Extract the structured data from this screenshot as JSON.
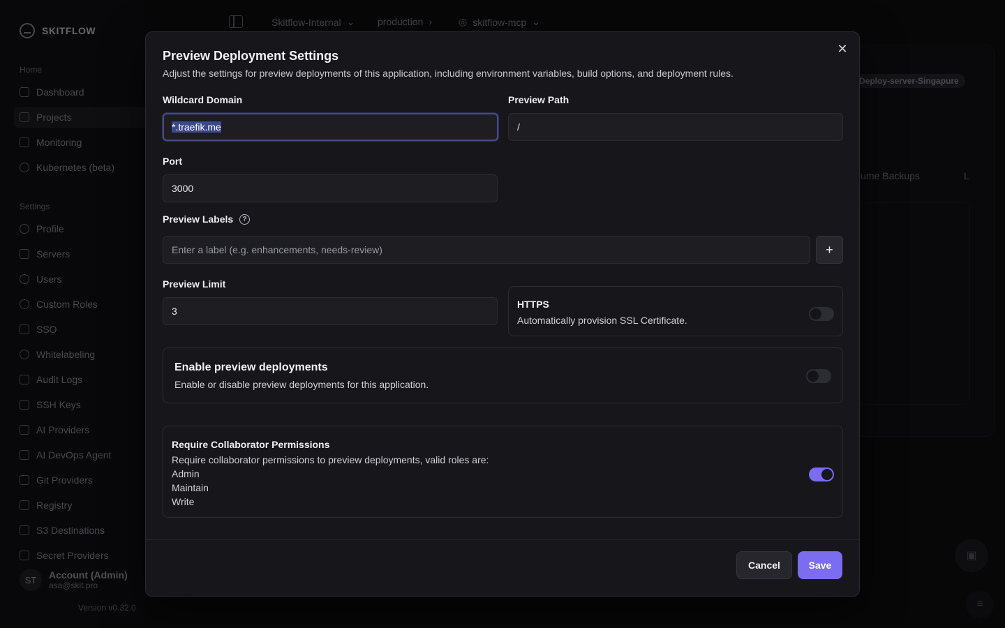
{
  "app": {
    "brand": "SKITFLOW",
    "sections": {
      "home": "Home",
      "settings": "Settings"
    },
    "nav_home": [
      "Dashboard",
      "Projects",
      "Monitoring",
      "Kubernetes (beta)"
    ],
    "nav_settings": [
      "Profile",
      "Servers",
      "Users",
      "Custom Roles",
      "SSO",
      "Whitelabeling",
      "Audit Logs",
      "SSH Keys",
      "AI Providers",
      "AI DevOps Agent",
      "Git Providers",
      "Registry",
      "S3 Destinations",
      "Secret Providers"
    ],
    "account": {
      "initials": "ST",
      "name": "Account (Admin)",
      "email": "asa@skit.pro"
    },
    "version": "Version v0.32.0",
    "breadcrumb": {
      "org": "Skitflow-Internal",
      "env": "production",
      "service": "skitflow-mcp"
    },
    "bg_badge": "Deploy-server-Singapure",
    "bg_tab": "lume Backups",
    "bg_tab_extra": "L"
  },
  "modal": {
    "title": "Preview Deployment Settings",
    "description": "Adjust the settings for preview deployments of this application, including environment variables, build options, and deployment rules.",
    "wildcard_domain": {
      "label": "Wildcard Domain",
      "value": "*.traefik.me"
    },
    "preview_path": {
      "label": "Preview Path",
      "value": "/"
    },
    "port": {
      "label": "Port",
      "value": "3000"
    },
    "preview_labels": {
      "label": "Preview Labels",
      "placeholder": "Enter a label (e.g. enhancements, needs-review)",
      "add_symbol": "+"
    },
    "preview_limit": {
      "label": "Preview Limit",
      "value": "3"
    },
    "https": {
      "title": "HTTPS",
      "description": "Automatically provision SSL Certificate.",
      "enabled": false
    },
    "enable_preview": {
      "title": "Enable preview deployments",
      "description": "Enable or disable preview deployments for this application.",
      "enabled": false
    },
    "collaborator": {
      "title": "Require Collaborator Permissions",
      "description": "Require collaborator permissions to preview deployments, valid roles are:",
      "roles": [
        "Admin",
        "Maintain",
        "Write"
      ],
      "enabled": true
    },
    "cancel_label": "Cancel",
    "save_label": "Save",
    "close_symbol": "✕",
    "help_symbol": "?"
  }
}
